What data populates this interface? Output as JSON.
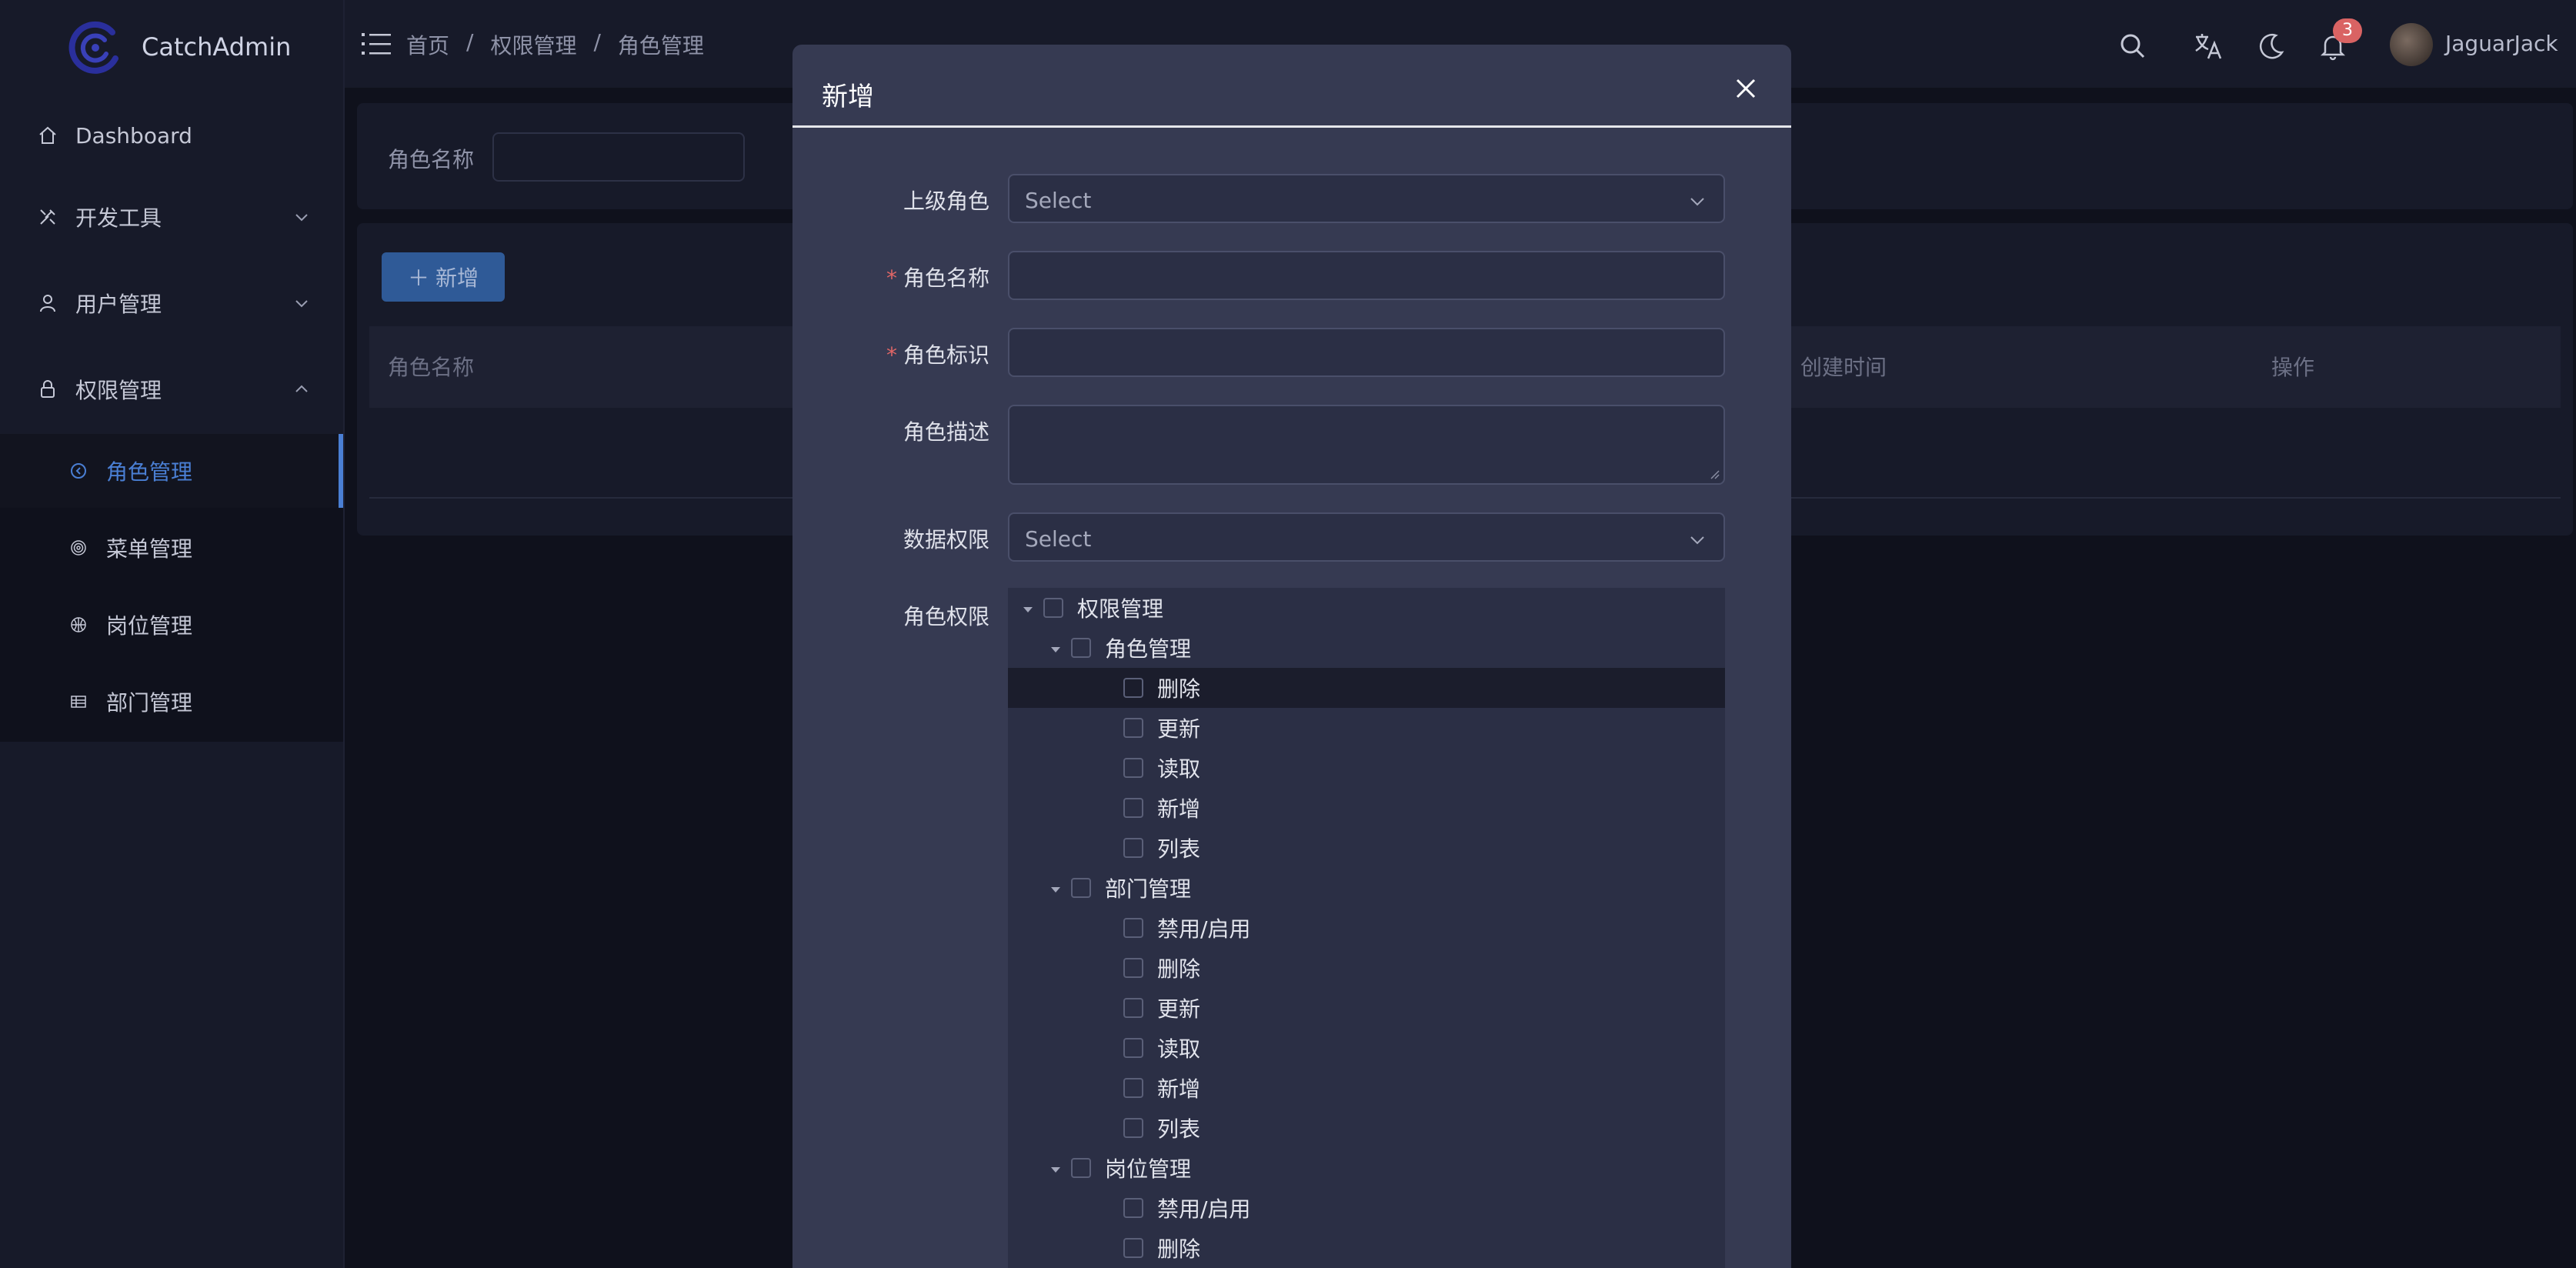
{
  "app": {
    "name": "CatchAdmin"
  },
  "sidebar": {
    "items": [
      {
        "label": "Dashboard"
      },
      {
        "label": "开发工具"
      },
      {
        "label": "用户管理"
      },
      {
        "label": "权限管理"
      },
      {
        "label": "角色管理"
      },
      {
        "label": "菜单管理"
      },
      {
        "label": "岗位管理"
      },
      {
        "label": "部门管理"
      }
    ]
  },
  "header": {
    "breadcrumb": [
      "首页",
      "/",
      "权限管理",
      "/",
      "角色管理"
    ],
    "notification_count": "3",
    "username": "JaguarJack"
  },
  "search": {
    "label": "角色名称"
  },
  "toolbar": {
    "add_label": "新增"
  },
  "table": {
    "columns": [
      "角色名称",
      "创建时间",
      "操作"
    ]
  },
  "modal": {
    "title": "新增",
    "fields": {
      "parent_role": {
        "label": "上级角色",
        "placeholder": "Select"
      },
      "role_name": {
        "label": "角色名称",
        "required": "*"
      },
      "role_key": {
        "label": "角色标识",
        "required": "*"
      },
      "role_desc": {
        "label": "角色描述"
      },
      "data_scope": {
        "label": "数据权限",
        "placeholder": "Select"
      },
      "role_perms": {
        "label": "角色权限"
      }
    },
    "tree": [
      {
        "label": "权限管理",
        "level": 0
      },
      {
        "label": "角色管理",
        "level": 1
      },
      {
        "label": "删除",
        "level": 2
      },
      {
        "label": "更新",
        "level": 2
      },
      {
        "label": "读取",
        "level": 2
      },
      {
        "label": "新增",
        "level": 2
      },
      {
        "label": "列表",
        "level": 2
      },
      {
        "label": "部门管理",
        "level": 1
      },
      {
        "label": "禁用/启用",
        "level": 2
      },
      {
        "label": "删除",
        "level": 2
      },
      {
        "label": "更新",
        "level": 2
      },
      {
        "label": "读取",
        "level": 2
      },
      {
        "label": "新增",
        "level": 2
      },
      {
        "label": "列表",
        "level": 2
      },
      {
        "label": "岗位管理",
        "level": 1
      },
      {
        "label": "禁用/启用",
        "level": 2
      },
      {
        "label": "删除",
        "level": 2
      }
    ]
  },
  "colors": {
    "accent": "#4a7fd4",
    "badge": "#d96363",
    "primary_button": "#2f5a97"
  }
}
